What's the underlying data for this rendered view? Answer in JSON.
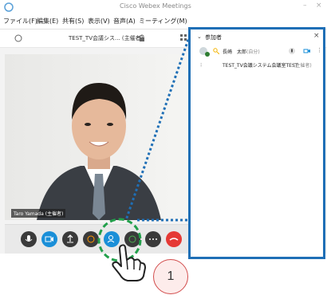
{
  "window": {
    "title": "Cisco Webex Meetings",
    "menus": [
      "ファイル(F)",
      "編集(E)",
      "共有(S)",
      "表示(V)",
      "音声(A)",
      "ミーティング(M)"
    ],
    "meeting_name": "TEST_TV会議シス... (主催者)",
    "video_name_tag": "Taro Yamada (主催者)"
  },
  "controls": [
    {
      "icon": "mic-icon"
    },
    {
      "icon": "video-icon"
    },
    {
      "icon": "share-icon"
    },
    {
      "icon": "emoji-icon"
    },
    {
      "icon": "participants-icon"
    },
    {
      "icon": "chat-icon"
    },
    {
      "icon": "more-icon"
    },
    {
      "icon": "end-call-icon"
    }
  ],
  "panel": {
    "header": "参加者",
    "participants": [
      {
        "name": "長崎　太郎",
        "role": "(自分)"
      },
      {
        "name": "TEST_TV会議システム会議室TEST",
        "role": "(主催者)"
      }
    ]
  },
  "annotation": {
    "step_number": "1"
  },
  "colors": {
    "panel_border": "#1f6fb6",
    "highlight_circle": "#22a04b",
    "step_circle_border": "#d24c4c",
    "control_active": "#1a8fd8"
  }
}
